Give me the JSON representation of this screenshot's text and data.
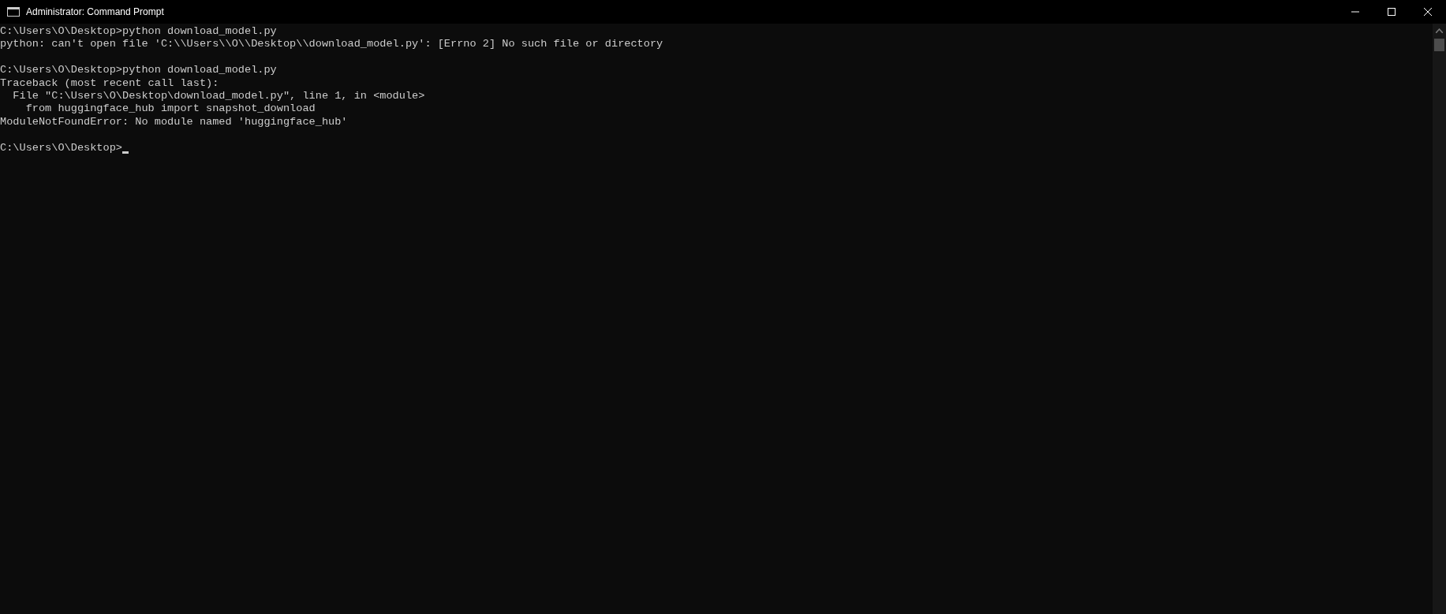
{
  "window": {
    "title": "Administrator: Command Prompt"
  },
  "console": {
    "lines": [
      {
        "kind": "output",
        "text": "C:\\Users\\O\\Desktop>python download_model.py"
      },
      {
        "kind": "output",
        "text": "python: can't open file 'C:\\\\Users\\\\O\\\\Desktop\\\\download_model.py': [Errno 2] No such file or directory"
      },
      {
        "kind": "blank"
      },
      {
        "kind": "output",
        "text": "C:\\Users\\O\\Desktop>python download_model.py"
      },
      {
        "kind": "output",
        "text": "Traceback (most recent call last):"
      },
      {
        "kind": "output",
        "text": "  File \"C:\\Users\\O\\Desktop\\download_model.py\", line 1, in <module>"
      },
      {
        "kind": "output",
        "text": "    from huggingface_hub import snapshot_download"
      },
      {
        "kind": "output",
        "text": "ModuleNotFoundError: No module named 'huggingface_hub'"
      },
      {
        "kind": "blank"
      },
      {
        "kind": "prompt",
        "text": "C:\\Users\\O\\Desktop>",
        "cursor": true
      }
    ]
  }
}
